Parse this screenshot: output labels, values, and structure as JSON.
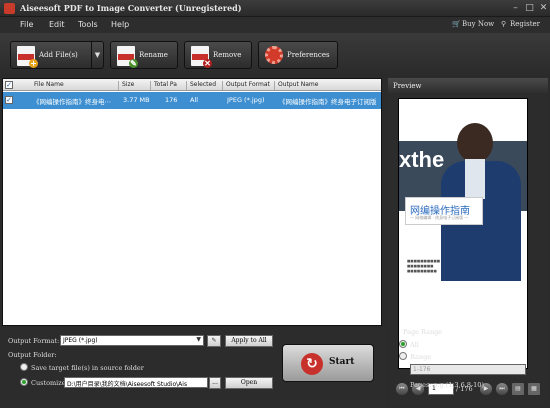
{
  "window": {
    "title": "Aiseesoft PDF to Image Converter (Unregistered)"
  },
  "menu": {
    "items": [
      "File",
      "Edit",
      "Tools",
      "Help"
    ],
    "buy_now": "Buy Now",
    "register": "Register"
  },
  "toolbar": {
    "add_files": "Add File(s)",
    "rename": "Rename",
    "remove": "Remove",
    "preferences": "Preferences"
  },
  "table": {
    "columns": [
      "File Name",
      "Size",
      "Total Pa",
      "Selected",
      "Output Format",
      "Output Name"
    ],
    "rows": [
      {
        "file_name": "《网编操作指南》终身电⋯",
        "size": "3.77 MB",
        "total_pages": "176",
        "selected": "All",
        "output_format": "JPEG (*.jpg)",
        "output_name": "《网编操作指南》终身电子订阅版"
      }
    ]
  },
  "output": {
    "format_label": "Output Format:",
    "format_value": "JPEG (*.jpg)",
    "apply_all": "Apply to All",
    "folder_label": "Output Folder:",
    "save_source": "Save target file(s) in source folder",
    "customize": "Customize",
    "folder_path": "D:\\用户目录\\我的文档\\Aiseesoft Studio\\Ais",
    "browse": "...",
    "open": "Open"
  },
  "start": {
    "label": "Start"
  },
  "preview": {
    "title": "Preview",
    "book_title": "网编操作指南",
    "book_sub": "— 网络编辑 · 终身电子订阅版 —",
    "bg_text": "xthe",
    "page_current": "1",
    "page_total": "/ 176"
  },
  "page_range": {
    "title": "Page Range",
    "all": "All",
    "range": "Range",
    "range_placeholder": "1-176",
    "pages_hint": "Pages: e.g.(1,3,6,8-10)"
  },
  "colors": {
    "accent": "#3d8fd1",
    "brand": "#c8312b",
    "bg": "#2b2b2b"
  }
}
